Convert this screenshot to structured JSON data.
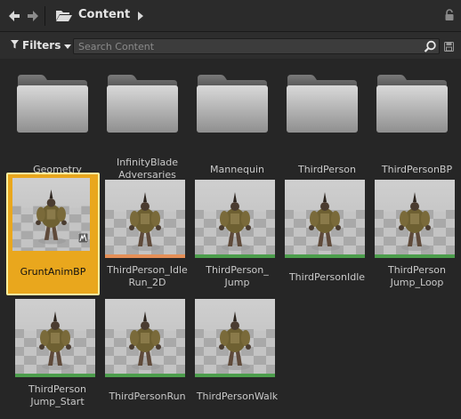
{
  "breadcrumb": {
    "back_icon": "arrow-left-icon",
    "forward_icon": "arrow-right-icon",
    "folder_icon": "folder-open-icon",
    "current": "Content",
    "lock_icon": "lock-icon"
  },
  "filters": {
    "label": "Filters",
    "search_placeholder": "Search Content",
    "search_value": ""
  },
  "folders": [
    {
      "name": "Geometry"
    },
    {
      "name": "InfinityBlade Adversaries",
      "line1": "InfinityBlade",
      "line2": "Adversaries"
    },
    {
      "name": "Mannequin"
    },
    {
      "name": "ThirdPerson"
    },
    {
      "name": "ThirdPersonBP"
    }
  ],
  "assets": [
    {
      "name": "GruntAnimBP",
      "line1": "GruntAnimBP",
      "line2": "",
      "type": "animation-blueprint",
      "selected": true,
      "bar_color": "#e9a71d"
    },
    {
      "name": "ThirdPerson_IdleRun_2D",
      "line1": "ThirdPerson_Idle",
      "line2": "Run_2D",
      "type": "blend-space",
      "selected": false,
      "bar_color": "#e58f57"
    },
    {
      "name": "ThirdPerson_Jump",
      "line1": "ThirdPerson_",
      "line2": "Jump",
      "type": "animation-sequence",
      "selected": false,
      "bar_color": "#4c9e4c"
    },
    {
      "name": "ThirdPersonIdle",
      "line1": "ThirdPersonIdle",
      "line2": "",
      "type": "animation-sequence",
      "selected": false,
      "bar_color": "#4c9e4c"
    },
    {
      "name": "ThirdPersonJump_Loop",
      "line1": "ThirdPerson",
      "line2": "Jump_Loop",
      "type": "animation-sequence",
      "selected": false,
      "bar_color": "#4c9e4c"
    },
    {
      "name": "ThirdPersonJump_Start",
      "line1": "ThirdPerson",
      "line2": "Jump_Start",
      "type": "animation-sequence",
      "selected": false,
      "bar_color": "#4c9e4c"
    },
    {
      "name": "ThirdPersonRun",
      "line1": "ThirdPersonRun",
      "line2": "",
      "type": "animation-sequence",
      "selected": false,
      "bar_color": "#4c9e4c"
    },
    {
      "name": "ThirdPersonWalk",
      "line1": "ThirdPersonWalk",
      "line2": "",
      "type": "animation-sequence",
      "selected": false,
      "bar_color": "#4c9e4c"
    }
  ],
  "colors": {
    "selection": "#e9a71d",
    "selection_border": "#fff2a0",
    "anim_sequence": "#4c9e4c",
    "blend_space": "#e58f57"
  }
}
